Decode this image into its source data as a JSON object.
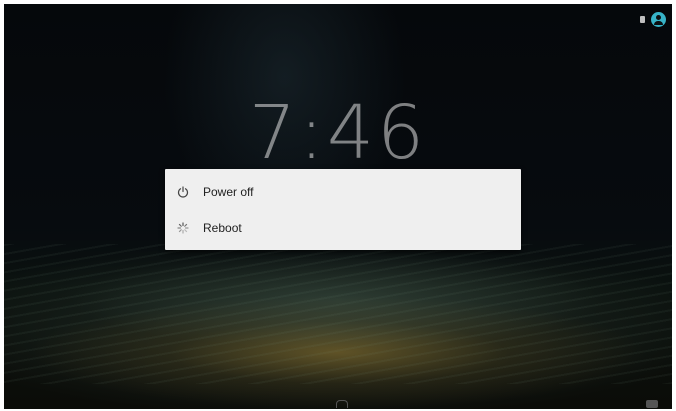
{
  "lockscreen": {
    "clock": "7:46",
    "colors": {
      "accent": "#37b3c8",
      "dialog_bg": "#efefef"
    }
  },
  "status_bar": {
    "icons": [
      "sim-card-icon",
      "user-avatar-icon"
    ]
  },
  "power_menu": {
    "items": [
      {
        "label": "Power off",
        "icon": "power-icon"
      },
      {
        "label": "Reboot",
        "icon": "reboot-spinner-icon"
      }
    ]
  },
  "bottom_bar": {
    "icons": [
      "lock-icon",
      "camera-icon"
    ]
  }
}
